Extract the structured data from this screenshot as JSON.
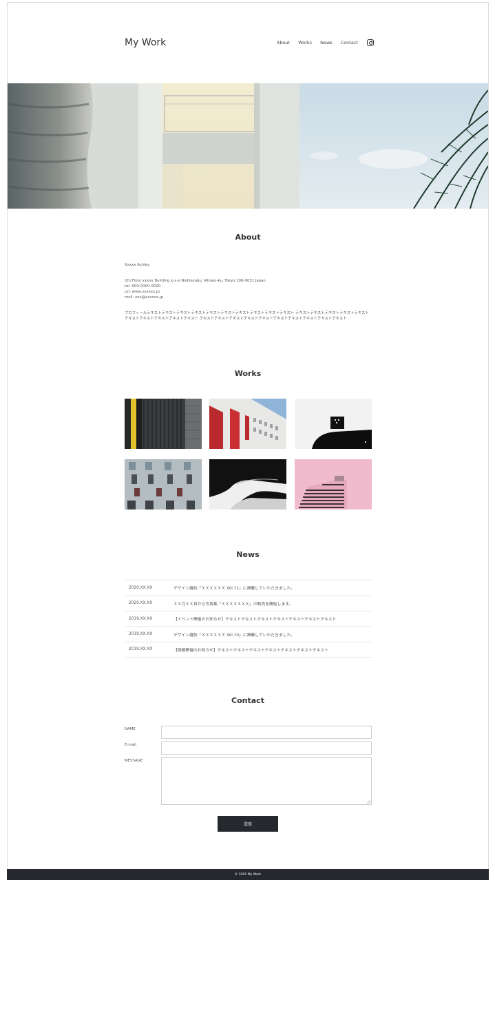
{
  "header": {
    "logo": "My Work",
    "nav": [
      "About",
      "Works",
      "News",
      "Contact"
    ]
  },
  "about": {
    "title": "About",
    "name": "Xxxxx Ashley",
    "address": "2th Floor xxxxx Building x-x-x Nishiazabu, Minato-ku, Tokyo 106-0031 Japan",
    "tel": "tel: 000-0000-0000",
    "url": "url: www.xxxxxx.jp",
    "mail": "mail: xxx@xxxxxx.jp",
    "profile": "プロフィールテキストテキストテキストテキストテキストテキストテキストテキストテキストテキスト テキストテキストテキストテキストテキストテキストテキストテキストテキストテキスト テキストテキストテキストテキストテキストテキストテキストテキストテキストテキスト"
  },
  "works": {
    "title": "Works"
  },
  "news": {
    "title": "News",
    "items": [
      {
        "date": "2020.XX.XX",
        "text": "デザイン雑誌「ＸＸＸＸＸＸ Vol.11」に掲載していただきました。"
      },
      {
        "date": "2020.XX.XX",
        "text": "ＸＸ月ＸＸ日から写真集「ＸＸＸＸＸＸＸ」の販売を開始します。"
      },
      {
        "date": "2019.XX.XX",
        "text": "【イベント開催のお知らせ】テキストテキストテキストテキストテキストテキストテキスト"
      },
      {
        "date": "2019.XX.XX",
        "text": "デザイン雑誌「ＸＸＸＸＸＸ Vol.10」に掲載していただきました。"
      },
      {
        "date": "2019.XX.XX",
        "text": "【個展開催のお知らせ】テキストテキストテキストテキストテキストテキストテキスト"
      }
    ]
  },
  "contact": {
    "title": "Contact",
    "name_label": "NAME",
    "email_label": "E-mail",
    "message_label": "MESSAGE",
    "submit": "送信"
  },
  "footer": {
    "copyright": "© 2020 My Work"
  },
  "colors": {
    "dark": "#25292d",
    "border": "#cfcfcf",
    "text": "#333333"
  },
  "icons": [
    "instagram-icon"
  ]
}
